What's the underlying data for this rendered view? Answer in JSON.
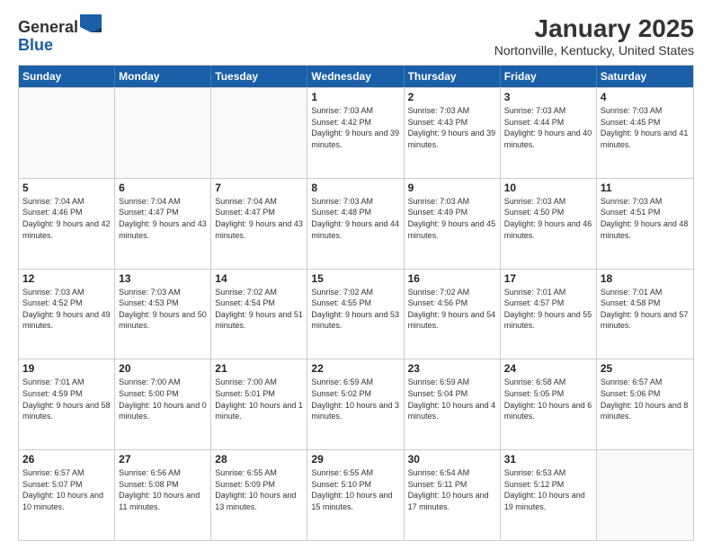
{
  "header": {
    "logo_general": "General",
    "logo_blue": "Blue",
    "month_title": "January 2025",
    "location": "Nortonville, Kentucky, United States"
  },
  "weekdays": [
    "Sunday",
    "Monday",
    "Tuesday",
    "Wednesday",
    "Thursday",
    "Friday",
    "Saturday"
  ],
  "weeks": [
    [
      {
        "day": "",
        "info": ""
      },
      {
        "day": "",
        "info": ""
      },
      {
        "day": "",
        "info": ""
      },
      {
        "day": "1",
        "info": "Sunrise: 7:03 AM\nSunset: 4:42 PM\nDaylight: 9 hours and 39 minutes."
      },
      {
        "day": "2",
        "info": "Sunrise: 7:03 AM\nSunset: 4:43 PM\nDaylight: 9 hours and 39 minutes."
      },
      {
        "day": "3",
        "info": "Sunrise: 7:03 AM\nSunset: 4:44 PM\nDaylight: 9 hours and 40 minutes."
      },
      {
        "day": "4",
        "info": "Sunrise: 7:03 AM\nSunset: 4:45 PM\nDaylight: 9 hours and 41 minutes."
      }
    ],
    [
      {
        "day": "5",
        "info": "Sunrise: 7:04 AM\nSunset: 4:46 PM\nDaylight: 9 hours and 42 minutes."
      },
      {
        "day": "6",
        "info": "Sunrise: 7:04 AM\nSunset: 4:47 PM\nDaylight: 9 hours and 43 minutes."
      },
      {
        "day": "7",
        "info": "Sunrise: 7:04 AM\nSunset: 4:47 PM\nDaylight: 9 hours and 43 minutes."
      },
      {
        "day": "8",
        "info": "Sunrise: 7:03 AM\nSunset: 4:48 PM\nDaylight: 9 hours and 44 minutes."
      },
      {
        "day": "9",
        "info": "Sunrise: 7:03 AM\nSunset: 4:49 PM\nDaylight: 9 hours and 45 minutes."
      },
      {
        "day": "10",
        "info": "Sunrise: 7:03 AM\nSunset: 4:50 PM\nDaylight: 9 hours and 46 minutes."
      },
      {
        "day": "11",
        "info": "Sunrise: 7:03 AM\nSunset: 4:51 PM\nDaylight: 9 hours and 48 minutes."
      }
    ],
    [
      {
        "day": "12",
        "info": "Sunrise: 7:03 AM\nSunset: 4:52 PM\nDaylight: 9 hours and 49 minutes."
      },
      {
        "day": "13",
        "info": "Sunrise: 7:03 AM\nSunset: 4:53 PM\nDaylight: 9 hours and 50 minutes."
      },
      {
        "day": "14",
        "info": "Sunrise: 7:02 AM\nSunset: 4:54 PM\nDaylight: 9 hours and 51 minutes."
      },
      {
        "day": "15",
        "info": "Sunrise: 7:02 AM\nSunset: 4:55 PM\nDaylight: 9 hours and 53 minutes."
      },
      {
        "day": "16",
        "info": "Sunrise: 7:02 AM\nSunset: 4:56 PM\nDaylight: 9 hours and 54 minutes."
      },
      {
        "day": "17",
        "info": "Sunrise: 7:01 AM\nSunset: 4:57 PM\nDaylight: 9 hours and 55 minutes."
      },
      {
        "day": "18",
        "info": "Sunrise: 7:01 AM\nSunset: 4:58 PM\nDaylight: 9 hours and 57 minutes."
      }
    ],
    [
      {
        "day": "19",
        "info": "Sunrise: 7:01 AM\nSunset: 4:59 PM\nDaylight: 9 hours and 58 minutes."
      },
      {
        "day": "20",
        "info": "Sunrise: 7:00 AM\nSunset: 5:00 PM\nDaylight: 10 hours and 0 minutes."
      },
      {
        "day": "21",
        "info": "Sunrise: 7:00 AM\nSunset: 5:01 PM\nDaylight: 10 hours and 1 minute."
      },
      {
        "day": "22",
        "info": "Sunrise: 6:59 AM\nSunset: 5:02 PM\nDaylight: 10 hours and 3 minutes."
      },
      {
        "day": "23",
        "info": "Sunrise: 6:59 AM\nSunset: 5:04 PM\nDaylight: 10 hours and 4 minutes."
      },
      {
        "day": "24",
        "info": "Sunrise: 6:58 AM\nSunset: 5:05 PM\nDaylight: 10 hours and 6 minutes."
      },
      {
        "day": "25",
        "info": "Sunrise: 6:57 AM\nSunset: 5:06 PM\nDaylight: 10 hours and 8 minutes."
      }
    ],
    [
      {
        "day": "26",
        "info": "Sunrise: 6:57 AM\nSunset: 5:07 PM\nDaylight: 10 hours and 10 minutes."
      },
      {
        "day": "27",
        "info": "Sunrise: 6:56 AM\nSunset: 5:08 PM\nDaylight: 10 hours and 11 minutes."
      },
      {
        "day": "28",
        "info": "Sunrise: 6:55 AM\nSunset: 5:09 PM\nDaylight: 10 hours and 13 minutes."
      },
      {
        "day": "29",
        "info": "Sunrise: 6:55 AM\nSunset: 5:10 PM\nDaylight: 10 hours and 15 minutes."
      },
      {
        "day": "30",
        "info": "Sunrise: 6:54 AM\nSunset: 5:11 PM\nDaylight: 10 hours and 17 minutes."
      },
      {
        "day": "31",
        "info": "Sunrise: 6:53 AM\nSunset: 5:12 PM\nDaylight: 10 hours and 19 minutes."
      },
      {
        "day": "",
        "info": ""
      }
    ]
  ]
}
